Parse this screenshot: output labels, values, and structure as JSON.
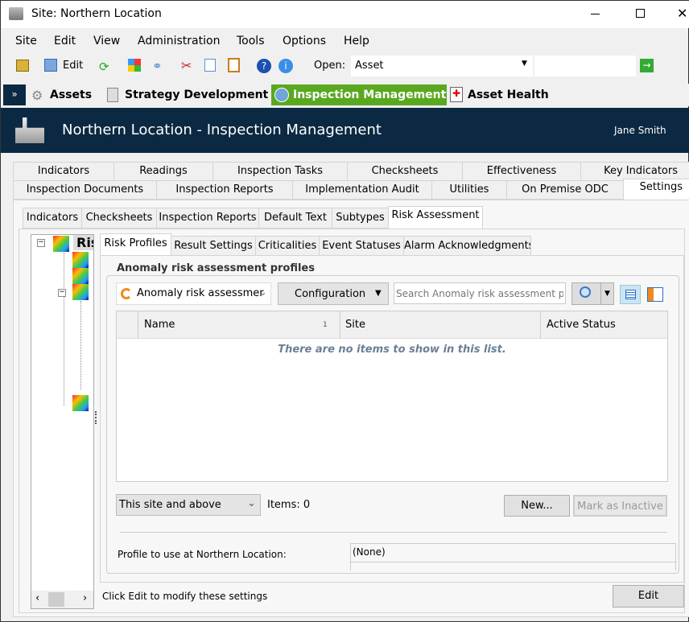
{
  "window": {
    "title": "Site: Northern Location"
  },
  "menu": [
    "Site",
    "Edit",
    "View",
    "Administration",
    "Tools",
    "Options",
    "Help"
  ],
  "toolbar": {
    "edit": "Edit",
    "open_label": "Open:",
    "open_value": "Asset",
    "open_input": ""
  },
  "modules": [
    {
      "label": "Assets"
    },
    {
      "label": "Strategy Development"
    },
    {
      "label": "Inspection Management",
      "active": true
    },
    {
      "label": "Asset Health"
    }
  ],
  "header": {
    "title": "Northern Location - Inspection Management",
    "user": "Jane Smith"
  },
  "tabs_row1": [
    "Indicators",
    "Readings",
    "Inspection Tasks",
    "Checksheets",
    "Effectiveness",
    "Key Indicators"
  ],
  "tabs_row2": [
    "Inspection Documents",
    "Inspection Reports",
    "Implementation Audit",
    "Utilities",
    "On Premise ODC",
    "Settings"
  ],
  "subtabs": [
    "Indicators",
    "Checksheets",
    "Inspection Reports",
    "Default Text",
    "Subtypes",
    "Risk Assessment"
  ],
  "tree": {
    "root": "Ris"
  },
  "risk_tabs": [
    "Risk Profiles",
    "Result Settings",
    "Criticalities",
    "Event Statuses",
    "Alarm Acknowledgments"
  ],
  "group": {
    "title": "Anomaly risk assessment profiles",
    "combo": "Anomaly risk assessmer",
    "config": "Configuration",
    "search_placeholder": "Search Anomaly risk assessment pr"
  },
  "grid": {
    "columns": [
      "Name",
      "Site",
      "Active Status"
    ],
    "sort_indicator": "1",
    "empty": "There are no items to show in this list."
  },
  "footer": {
    "scope": "This site and above",
    "items": "Items: 0",
    "new": "New...",
    "inactive": "Mark as Inactive",
    "profile_label": "Profile to use at Northern Location:",
    "profile_value": "(None)"
  },
  "status": {
    "text": "Click Edit to modify these settings",
    "edit": "Edit"
  },
  "colors": {
    "header_bg": "#0b2942",
    "module_active": "#5aa81f"
  }
}
